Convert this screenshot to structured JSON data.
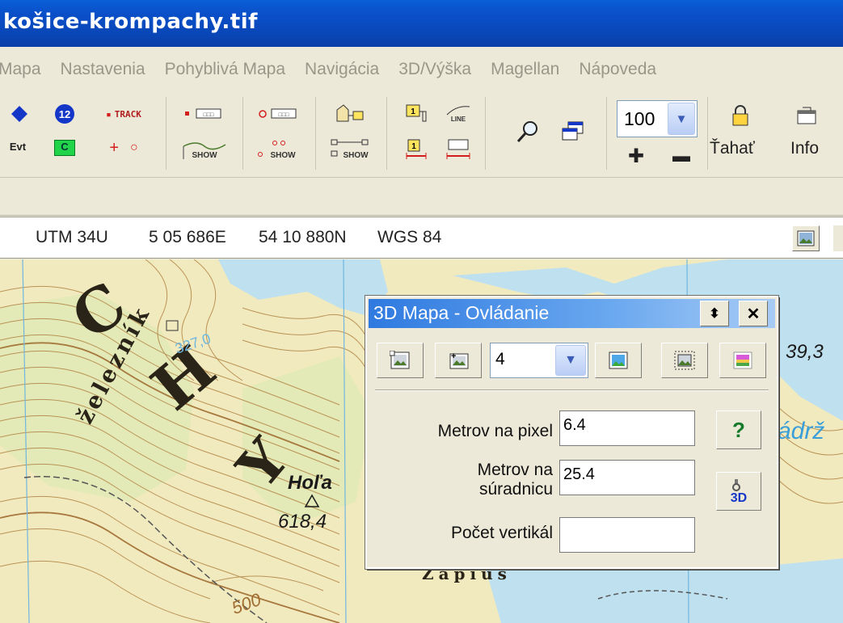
{
  "window": {
    "title": "košice-krompachy.tif"
  },
  "menu": {
    "items": [
      "Mapa",
      "Nastavenia",
      "Pohyblivá Mapa",
      "Navigácia",
      "3D/Výška",
      "Magellan",
      "Nápoveda"
    ]
  },
  "toolbar": {
    "evt_label": "Evt",
    "waypoint_number": "12",
    "c_label": "C",
    "track_label": "TRACK",
    "show_label": "SHOW",
    "line_label": "LINE",
    "zoom_value": "100",
    "tahat_label": "Ťahať",
    "info_label": "Info"
  },
  "coords": {
    "system": "UTM 34U",
    "easting": "5 05 686E",
    "northing": "54 10 880N",
    "datum": "WGS 84"
  },
  "map": {
    "labels": {
      "big_c": "C",
      "big_h": "H",
      "big_y": "Y",
      "zeleznik": "železník",
      "hola": "Hoľa",
      "hola_elev": "618,4",
      "elev_right": "39,3",
      "adr": "ádrž",
      "contour_500": "500",
      "zapius": "Zapius",
      "elev_small": "327,0"
    }
  },
  "dialog": {
    "title": "3D Mapa - Ovládanie",
    "combo_value": "4",
    "fields": {
      "metrov_na_pixel_label": "Metrov na pixel",
      "metrov_na_pixel_value": "6.4",
      "metrov_na_suradnicu_label_1": "Metrov na",
      "metrov_na_suradnicu_label_2": "súradnicu",
      "metrov_na_suradnicu_value": "25.4",
      "pocet_vertikal_label": "Počet vertikál",
      "pocet_vertikal_value": ""
    },
    "help_label": "?",
    "three_d_label": "3D"
  },
  "colors": {
    "titlebar": "#0a4fc8",
    "dialog_title": "#2f7ae0",
    "map_bg": "#f3ecc4",
    "water": "#bfe0ef",
    "contour": "#b48a4a",
    "forest": "#cfe3b0"
  }
}
